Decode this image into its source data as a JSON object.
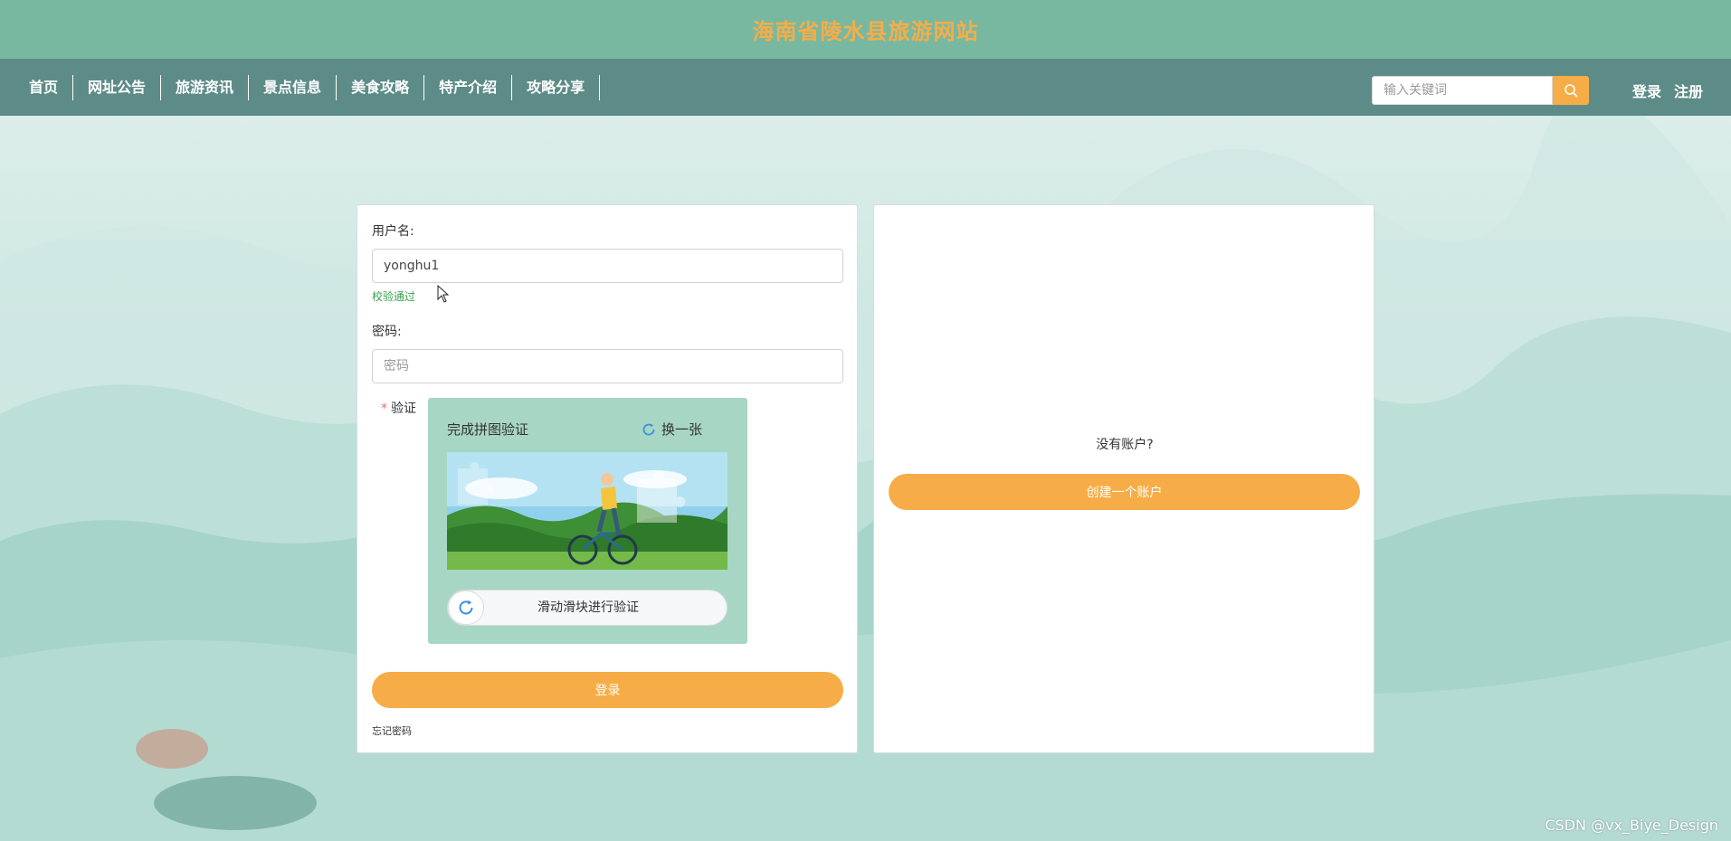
{
  "site": {
    "title": "海南省陵水县旅游网站"
  },
  "nav": {
    "items": [
      {
        "label": "首页"
      },
      {
        "label": "网址公告"
      },
      {
        "label": "旅游资讯"
      },
      {
        "label": "景点信息"
      },
      {
        "label": "美食攻略"
      },
      {
        "label": "特产介绍"
      },
      {
        "label": "攻略分享"
      }
    ],
    "search_placeholder": "输入关键词",
    "login_label": "登录",
    "register_label": "注册"
  },
  "login_form": {
    "username_label": "用户名:",
    "username_value": "yonghu1",
    "username_status": "校验通过",
    "password_label": "密码:",
    "password_placeholder": "密码",
    "verify_label": "验证",
    "captcha_title": "完成拼图验证",
    "captcha_refresh": "换一张",
    "slider_text": "滑动滑块进行验证",
    "submit_label": "登录",
    "forgot_label": "忘记密码"
  },
  "register_panel": {
    "prompt": "没有账户?",
    "create_label": "创建一个账户"
  },
  "colors": {
    "header_bg": "#79b8a0",
    "nav_bg": "#5d8c88",
    "accent": "#f6ad47",
    "success": "#3aa149"
  },
  "watermark": "CSDN @vx_Biye_Design"
}
